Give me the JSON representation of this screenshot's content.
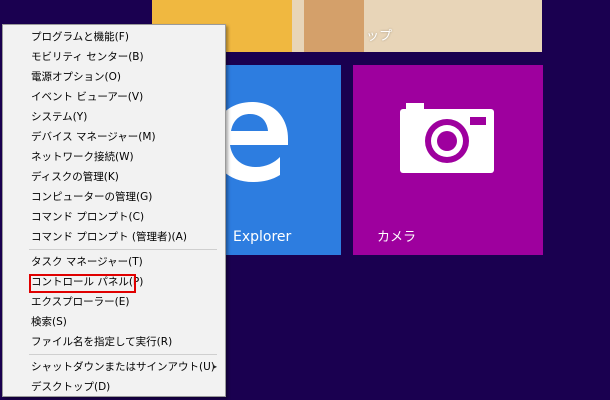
{
  "tiles": {
    "desktop_label": "ップ",
    "ie_label": "Explorer",
    "camera_label": "カメラ"
  },
  "menu": {
    "items": [
      "プログラムと機能(F)",
      "モビリティ センター(B)",
      "電源オプション(O)",
      "イベント ビューアー(V)",
      "システム(Y)",
      "デバイス マネージャー(M)",
      "ネットワーク接続(W)",
      "ディスクの管理(K)",
      "コンピューターの管理(G)",
      "コマンド プロンプト(C)",
      "コマンド プロンプト (管理者)(A)",
      "タスク マネージャー(T)",
      "コントロール パネル(P)",
      "エクスプローラー(E)",
      "検索(S)",
      "ファイル名を指定して実行(R)",
      "シャットダウンまたはサインアウト(U)",
      "デスクトップ(D)"
    ],
    "submenu_arrow": "▸"
  },
  "colors": {
    "background": "#1a0050",
    "ie_tile": "#2d7de0",
    "camera_tile": "#9e009e",
    "highlight": "#e00000"
  },
  "icons": {
    "ie": "internet-explorer-icon",
    "camera": "camera-icon",
    "submenu": "chevron-right-icon"
  }
}
